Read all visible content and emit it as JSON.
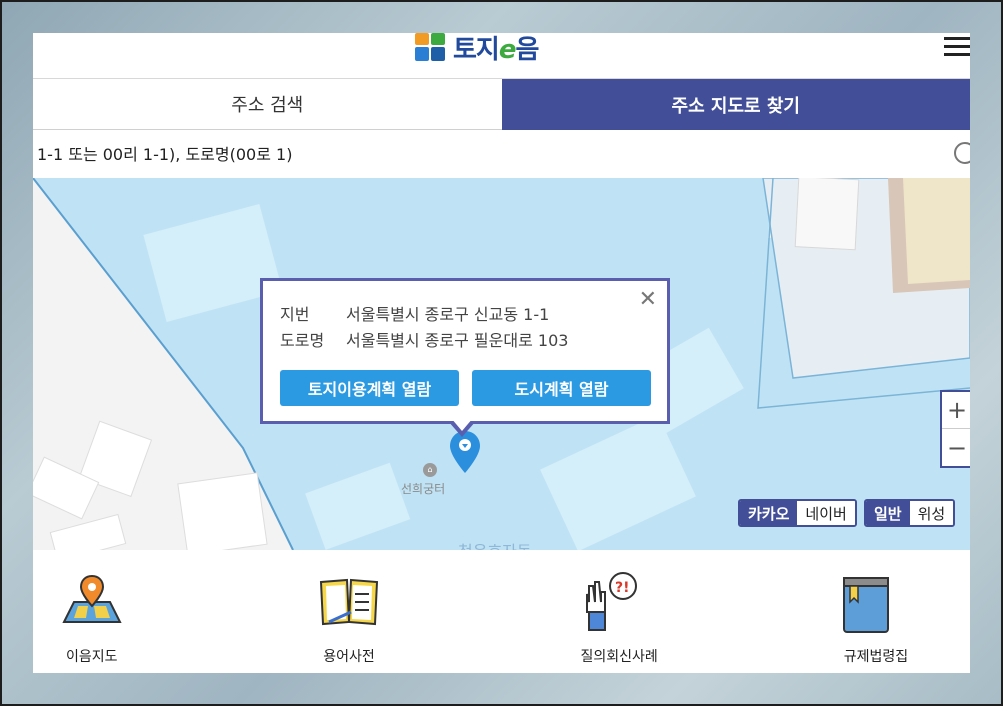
{
  "header": {
    "logo_text_1": "토지",
    "logo_text_2": "e",
    "logo_text_3": "음"
  },
  "tabs": [
    {
      "label": "주소 검색",
      "active": false
    },
    {
      "label": "주소 지도로 찾기",
      "active": true
    }
  ],
  "search": {
    "value": "",
    "placeholder": "1-1 또는 00리 1-1), 도로명(00로 1)"
  },
  "popup": {
    "jibun_key": "지번",
    "jibun_value": "서울특별시 종로구 신교동 1-1",
    "road_key": "도로명",
    "road_value": "서울특별시 종로구 필운대로 103",
    "btn_land": "토지이용계획 열람",
    "btn_city": "도시계획 열람",
    "close": "✕"
  },
  "map": {
    "poi_label": "선희궁터",
    "road_label": "청운효자동",
    "zoom_in": "+",
    "zoom_out": "−",
    "provider_toggle": [
      "카카오",
      "네이버"
    ],
    "view_toggle": [
      "일반",
      "위성"
    ]
  },
  "bottom_nav": [
    {
      "label": "이음지도",
      "icon": "map-pin-icon"
    },
    {
      "label": "용어사전",
      "icon": "open-book-icon"
    },
    {
      "label": "질의회신사례",
      "icon": "question-hand-icon"
    },
    {
      "label": "규제법령집",
      "icon": "law-book-icon"
    }
  ],
  "colors": {
    "accent": "#424f98",
    "button": "#2b9ae3",
    "zone": "#bfe3f5"
  }
}
